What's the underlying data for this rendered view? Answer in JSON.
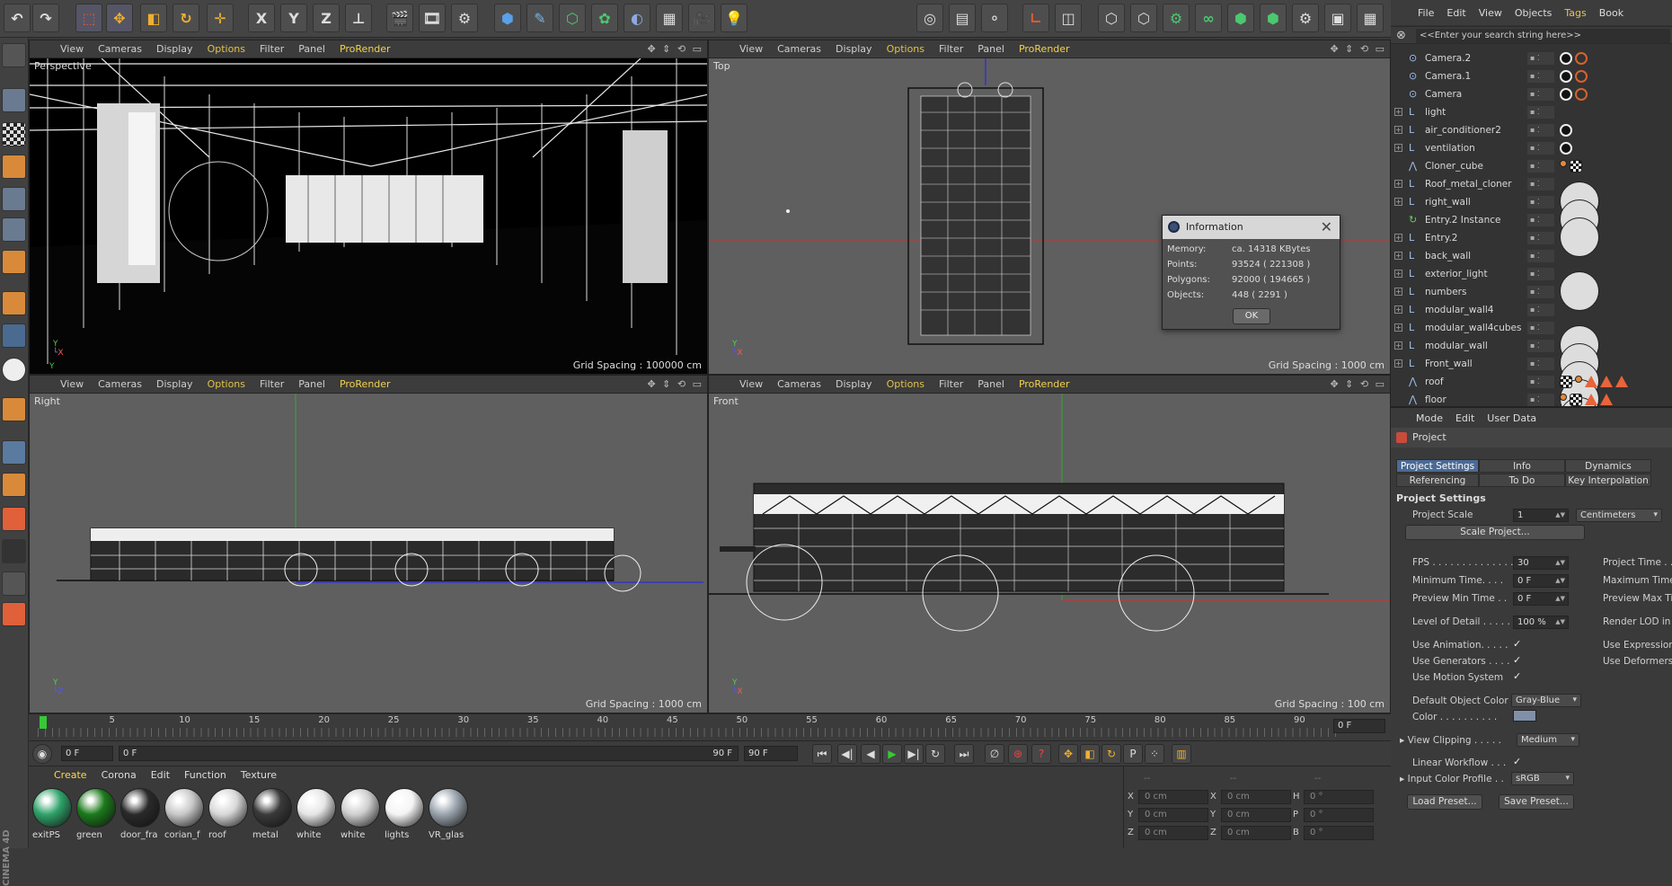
{
  "toolbar": {
    "axes": [
      "X",
      "Y",
      "Z"
    ]
  },
  "viewports": {
    "menu": [
      "View",
      "Cameras",
      "Display",
      "Options",
      "Filter",
      "Panel",
      "ProRender"
    ],
    "perspective": {
      "label": "Perspective",
      "grid": "Grid Spacing : 100000 cm"
    },
    "top": {
      "label": "Top",
      "grid": "Grid Spacing : 1000 cm"
    },
    "right": {
      "label": "Right",
      "grid": "Grid Spacing : 1000 cm"
    },
    "front": {
      "label": "Front",
      "grid": "Grid Spacing : 100 cm"
    }
  },
  "info_dialog": {
    "title": "Information",
    "rows": [
      {
        "label": "Memory:",
        "value": "ca. 14318 KBytes"
      },
      {
        "label": "Points:",
        "value": "93524 ( 221308 )"
      },
      {
        "label": "Polygons:",
        "value": "92000 ( 194665 )"
      },
      {
        "label": "Objects:",
        "value": "448 ( 2291 )"
      }
    ],
    "ok": "OK"
  },
  "object_manager": {
    "menu": [
      "File",
      "Edit",
      "View",
      "Objects",
      "Tags",
      "Book"
    ],
    "search_placeholder": "<<Enter your search string here>>",
    "objects": [
      {
        "name": "Camera.2",
        "icon": "camera",
        "tags": [
          "cam",
          "no"
        ]
      },
      {
        "name": "Camera.1",
        "icon": "camera",
        "tags": [
          "cam",
          "no"
        ]
      },
      {
        "name": "Camera",
        "icon": "camera",
        "tags": [
          "cam",
          "no"
        ]
      },
      {
        "name": "light",
        "icon": "null",
        "tags": []
      },
      {
        "name": "air_conditioner2",
        "icon": "null",
        "tags": [
          "cam"
        ]
      },
      {
        "name": "ventilation",
        "icon": "null",
        "tags": [
          "cam"
        ]
      },
      {
        "name": "Cloner_cube",
        "icon": "cloner",
        "tags": [
          "dot",
          "chk",
          "mat"
        ]
      },
      {
        "name": "Roof_metal_cloner",
        "icon": "null",
        "tags": [
          "mat"
        ]
      },
      {
        "name": "right_wall",
        "icon": "null",
        "tags": [
          "mat"
        ]
      },
      {
        "name": "Entry.2 Instance",
        "icon": "instance",
        "tags": []
      },
      {
        "name": "Entry.2",
        "icon": "null",
        "tags": []
      },
      {
        "name": "back_wall",
        "icon": "null",
        "tags": [
          "mat"
        ]
      },
      {
        "name": "exterior_light",
        "icon": "null",
        "tags": []
      },
      {
        "name": "numbers",
        "icon": "null",
        "tags": []
      },
      {
        "name": "modular_wall4",
        "icon": "null",
        "tags": [
          "mat"
        ]
      },
      {
        "name": "modular_wall4cubes",
        "icon": "null",
        "tags": [
          "mat"
        ]
      },
      {
        "name": "modular_wall",
        "icon": "null",
        "tags": [
          "mat"
        ]
      },
      {
        "name": "Front_wall",
        "icon": "null",
        "tags": [
          "mat"
        ]
      },
      {
        "name": "roof",
        "icon": "cloner",
        "tags": [
          "chk",
          "dot",
          "tri",
          "tri",
          "tri",
          "mat"
        ]
      },
      {
        "name": "floor",
        "icon": "cloner",
        "tags": [
          "dot",
          "chk",
          "tri",
          "tri",
          "mat"
        ]
      }
    ]
  },
  "attribute_manager": {
    "menu": [
      "Mode",
      "Edit",
      "User Data"
    ],
    "title": "Project",
    "tabs_row1": [
      "Project Settings",
      "Info",
      "Dynamics"
    ],
    "tabs_row2": [
      "Referencing",
      "To Do",
      "Key Interpolation"
    ],
    "section": "Project Settings",
    "project_scale_label": "Project Scale",
    "project_scale_value": "1",
    "project_scale_unit": "Centimeters",
    "scale_project_btn": "Scale Project...",
    "fps_label": "FPS . . . . . . . . . . . . . .",
    "fps_value": "30",
    "project_time_label": "Project Time . .",
    "min_time_label": "Minimum Time. . . .",
    "min_time_value": "0 F",
    "max_time_label": "Maximum Time",
    "preview_min_label": "Preview Min Time . .",
    "preview_min_value": "0 F",
    "preview_max_label": "Preview Max Ti",
    "lod_label": "Level of Detail . . . . .",
    "lod_value": "100 %",
    "render_lod_label": "Render LOD in",
    "use_animation_label": "Use Animation. . . . .",
    "use_expression_label": "Use Expression",
    "use_generators_label": "Use Generators . . . .",
    "use_deformers_label": "Use Deformers",
    "use_motion_label": "Use Motion System",
    "check": "✓",
    "default_color_label": "Default Object Color",
    "default_color_value": "Gray-Blue",
    "color_label": "Color . . . . . . . . . .",
    "view_clipping_label": "View Clipping . . . . .",
    "view_clipping_value": "Medium",
    "linear_workflow_label": "Linear Workflow . . .",
    "input_color_label": "Input Color Profile . .",
    "input_color_value": "sRGB",
    "load_preset": "Load Preset...",
    "save_preset": "Save Preset..."
  },
  "timeline": {
    "ticks": [
      "0",
      "5",
      "10",
      "15",
      "20",
      "25",
      "30",
      "35",
      "40",
      "45",
      "50",
      "55",
      "60",
      "65",
      "70",
      "75",
      "80",
      "85",
      "90"
    ],
    "current_frame": "0 F"
  },
  "transport": {
    "start": "0 F",
    "range_start": "0 F",
    "range_end": "90 F",
    "end": "90 F"
  },
  "material_manager": {
    "menu": [
      "Create",
      "Corona",
      "Edit",
      "Function",
      "Texture"
    ],
    "materials": [
      {
        "name": "exitPS",
        "color": "#2fa36a"
      },
      {
        "name": "green",
        "color": "#1b7a1b"
      },
      {
        "name": "door_fra",
        "color": "#2a2a2a"
      },
      {
        "name": "corian_f",
        "color": "#c8c8c8"
      },
      {
        "name": "roof",
        "color": "#d8d8d8"
      },
      {
        "name": "metal",
        "color": "#3a3a3a"
      },
      {
        "name": "white",
        "color": "#e6e6e6"
      },
      {
        "name": "white",
        "color": "#cfcfcf"
      },
      {
        "name": "lights",
        "color": "#f4f4f4"
      },
      {
        "name": "VR_glas",
        "color": "#9aa4ad"
      }
    ]
  },
  "coordinates": {
    "rows": [
      {
        "a": "X",
        "av": "0 cm",
        "b": "X",
        "bv": "0 cm",
        "c": "H",
        "cv": "0 °"
      },
      {
        "a": "Y",
        "av": "0 cm",
        "b": "Y",
        "bv": "0 cm",
        "c": "P",
        "cv": "0 °"
      },
      {
        "a": "Z",
        "av": "0 cm",
        "b": "Z",
        "bv": "0 cm",
        "c": "B",
        "cv": "0 °"
      }
    ],
    "dashes": "--"
  },
  "brand": "CINEMA 4D"
}
